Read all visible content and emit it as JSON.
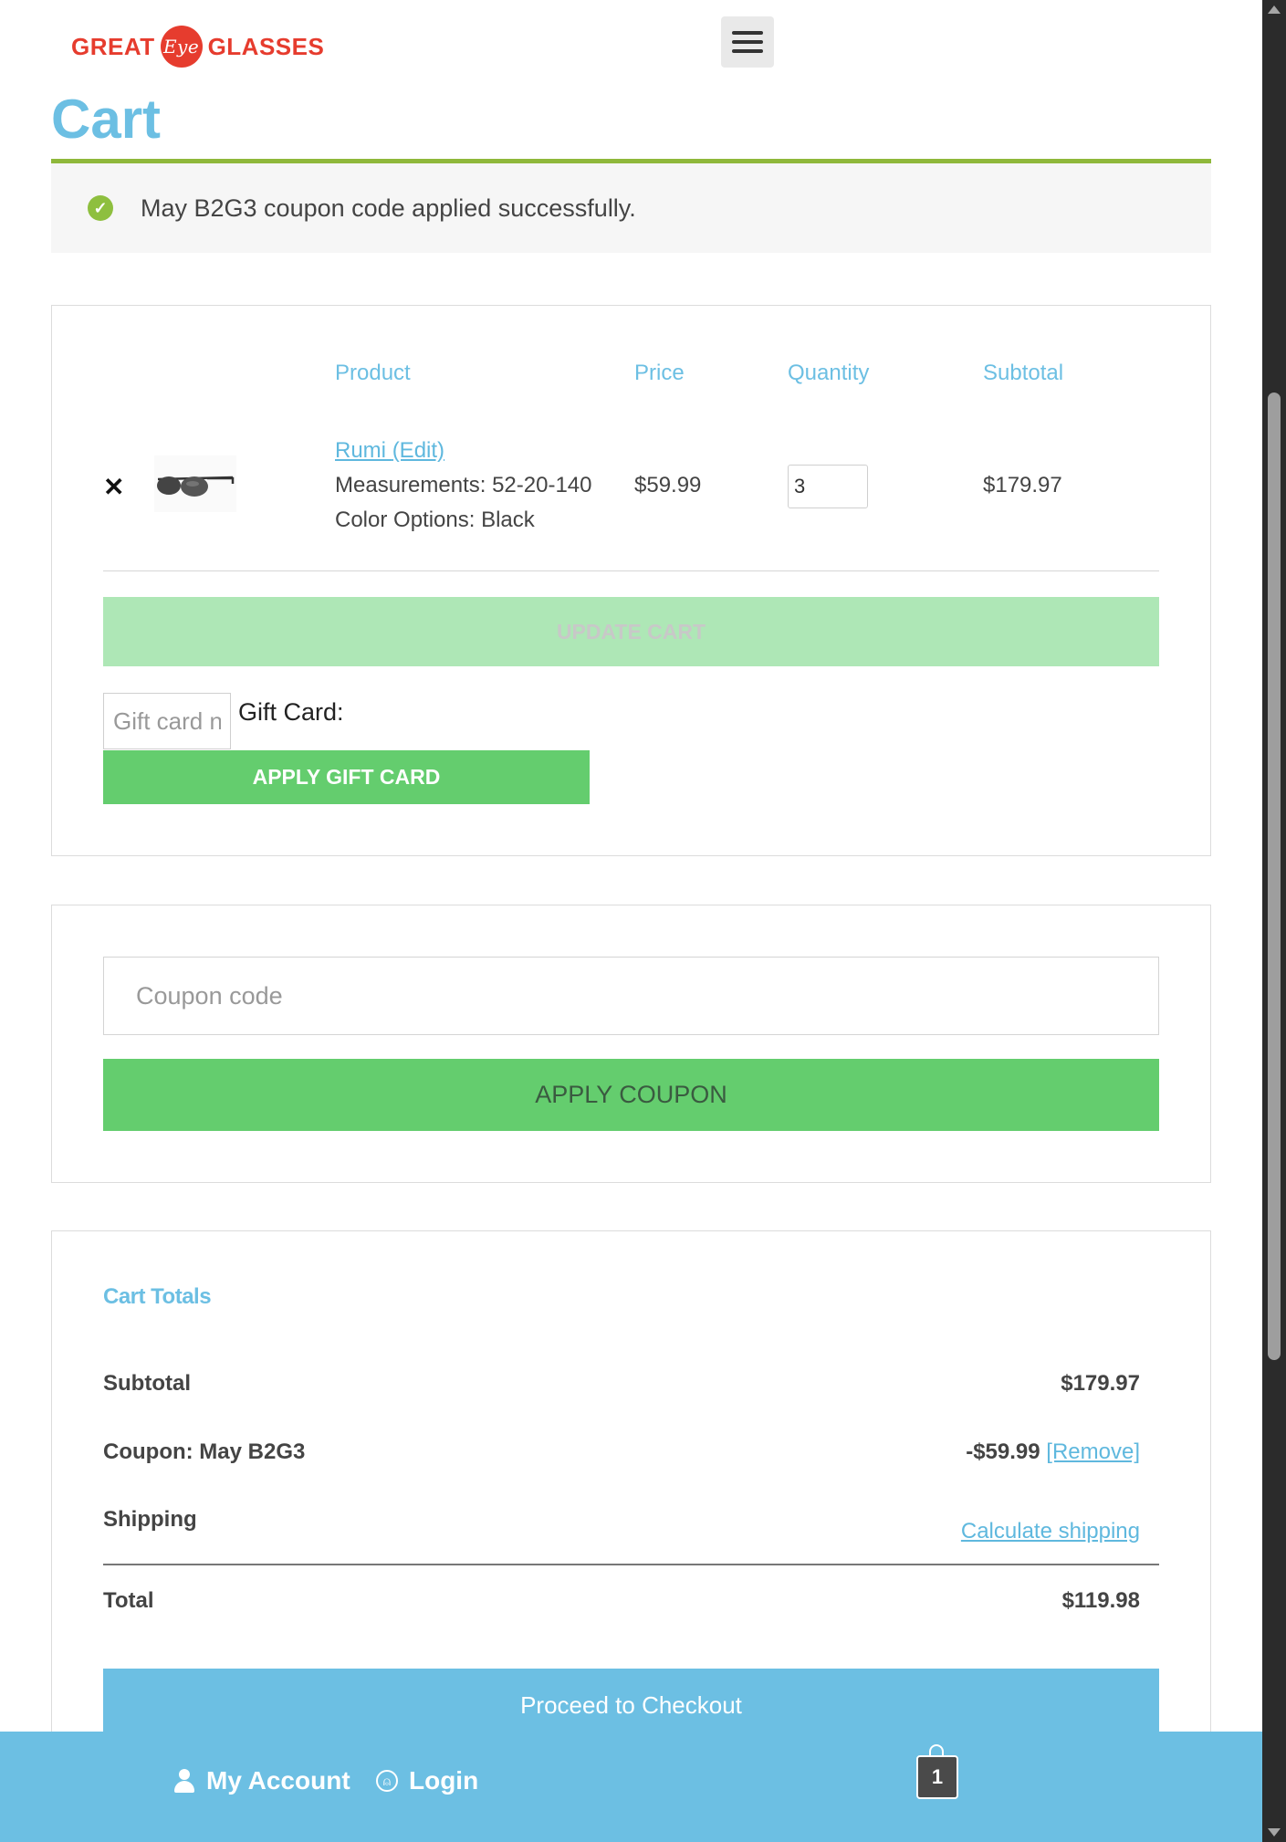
{
  "header": {
    "logo_left": "GREAT",
    "logo_eye": "Eye",
    "logo_right": "GLASSES",
    "menu_icon": "hamburger-icon"
  },
  "page": {
    "title": "Cart"
  },
  "notice": {
    "icon": "check-circle-icon",
    "message": "May B2G3 coupon code applied successfully."
  },
  "cart_table": {
    "headers": {
      "product": "Product",
      "price": "Price",
      "quantity": "Quantity",
      "subtotal": "Subtotal"
    },
    "items": [
      {
        "name": "Rumi",
        "edit_label": "(Edit)",
        "measurements": "Measurements: 52-20-140",
        "color": "Color Options: Black",
        "price": "$59.99",
        "quantity": "3",
        "subtotal": "$179.97"
      }
    ]
  },
  "actions": {
    "update_cart": "UPDATE CART",
    "gift_card_placeholder": "Gift card number",
    "gift_card_label": "Gift Card:",
    "apply_gift_card": "APPLY GIFT CARD",
    "coupon_placeholder": "Coupon code",
    "apply_coupon": "APPLY COUPON"
  },
  "totals": {
    "title": "Cart Totals",
    "subtotal_label": "Subtotal",
    "subtotal_value": "$179.97",
    "coupon_label": "Coupon: May B2G3",
    "coupon_value": "-$59.99",
    "coupon_remove": "[Remove]",
    "shipping_label": "Shipping",
    "shipping_link": "Calculate shipping",
    "total_label": "Total",
    "total_value": "$119.98",
    "checkout_button": "Proceed to Checkout"
  },
  "bottom_bar": {
    "account_label": "My Account",
    "login_label": "Login",
    "cart_count": "1"
  },
  "colors": {
    "accent_blue": "#6cbfe3",
    "success_green": "#8fb83b",
    "button_green": "#64cd6e",
    "logo_red": "#e63c2e"
  }
}
